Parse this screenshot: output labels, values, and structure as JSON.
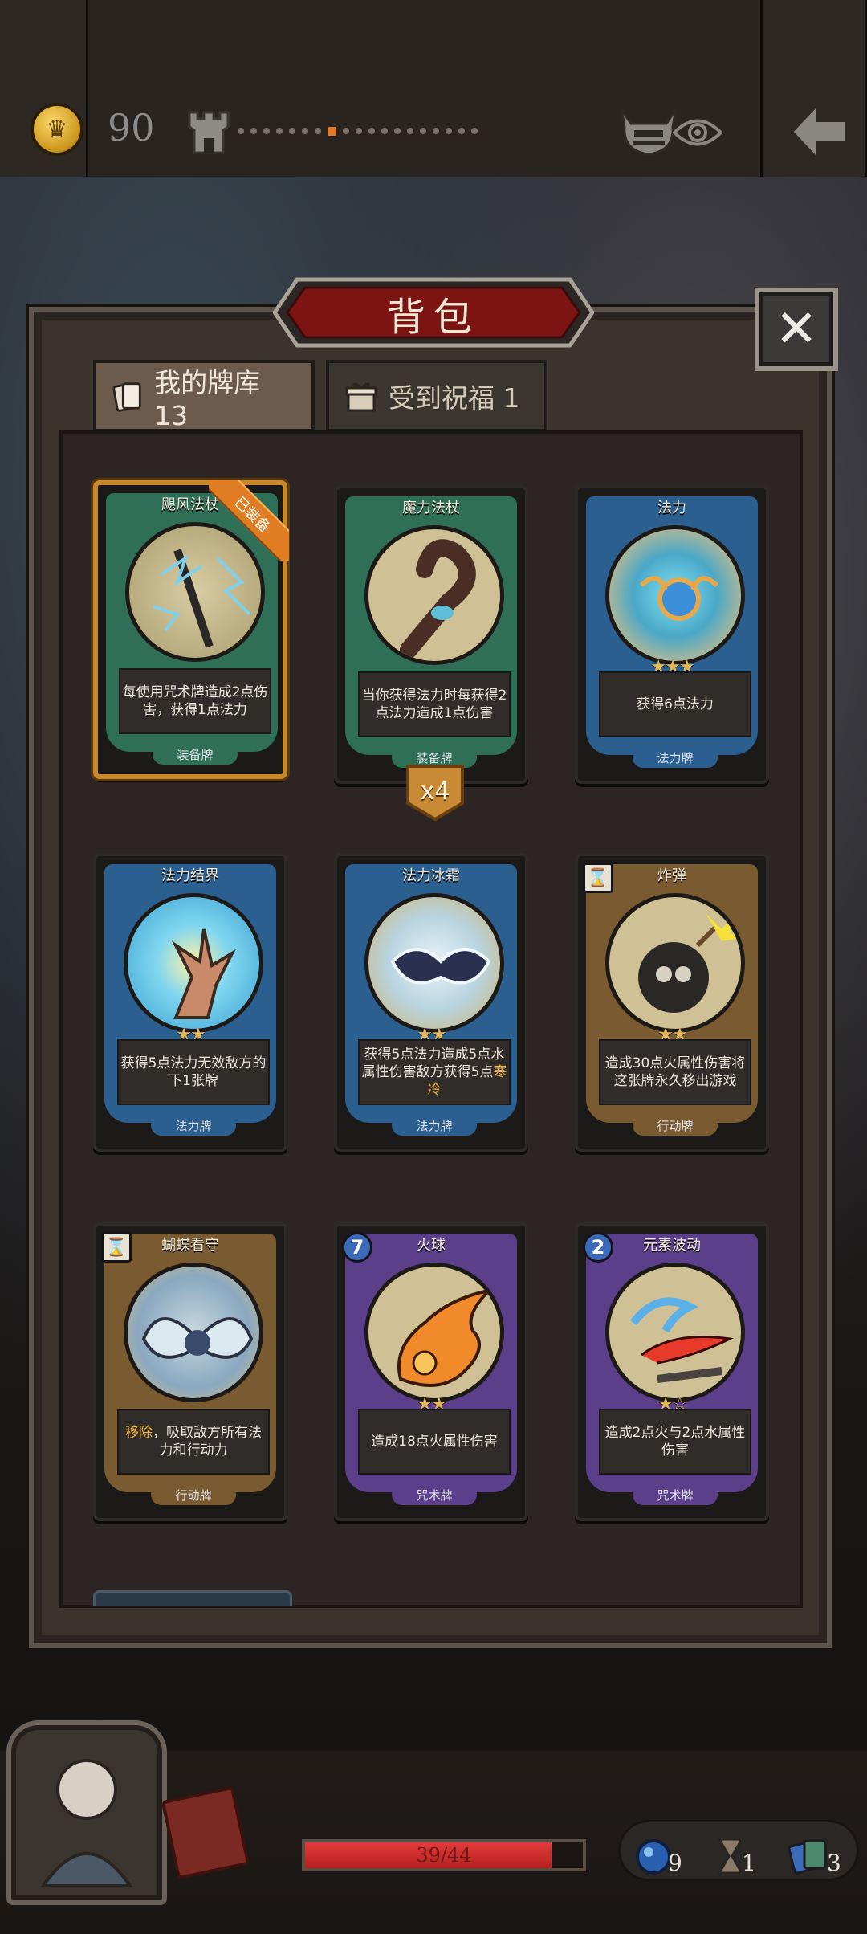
{
  "hud": {
    "gold": "90",
    "icons": [
      "coin-icon",
      "tower-icon",
      "boss-icon",
      "eye-icon",
      "back-arrow-icon"
    ],
    "path_nodes": 19,
    "path_current": 7
  },
  "panel": {
    "title": "背包",
    "close_symbol": "✕",
    "tabs": [
      {
        "label": "我的牌库 13",
        "active": true
      },
      {
        "label": "受到祝福 1",
        "active": false
      }
    ]
  },
  "cards": [
    {
      "name": "飓风法杖",
      "desc": "每使用咒术牌造成2点伤害，获得1点法力",
      "type": "装备牌",
      "badge": "已装备",
      "color": "#2f6f58",
      "stars": ""
    },
    {
      "name": "魔力法杖",
      "desc": "当你获得法力时每获得2点法力造成1点伤害",
      "type": "装备牌",
      "qty": "x4",
      "color": "#2f6f58",
      "stars": ""
    },
    {
      "name": "法力",
      "desc": "获得6点法力",
      "type": "法力牌",
      "color": "#2b5f8f",
      "stars": "★★★"
    },
    {
      "name": "法力结界",
      "desc": "获得5点法力无效敌方的下1张牌",
      "type": "法力牌",
      "color": "#2b5f8f",
      "stars": "★★"
    },
    {
      "name": "法力冰霜",
      "desc_pre": "获得5点法力造成5点水属性伤害敌方获得5点",
      "desc_hl": "寒冷",
      "type": "法力牌",
      "color": "#2b5f8f",
      "stars": "★★"
    },
    {
      "name": "炸弹",
      "cost": "⌛",
      "desc": "造成30点火属性伤害将这张牌永久移出游戏",
      "type": "行动牌",
      "color": "#7a5a30",
      "stars": "★★"
    },
    {
      "name": "蝴蝶看守",
      "cost": "⌛",
      "desc_hl": "移除",
      "desc_post": "，吸取敌方所有法力和行动力",
      "type": "行动牌",
      "color": "#7a5a30",
      "stars": ""
    },
    {
      "name": "火球",
      "cost": "7",
      "desc": "造成18点火属性伤害",
      "type": "咒术牌",
      "color": "#5c3f8a",
      "stars": "★★"
    },
    {
      "name": "元素波动",
      "cost": "2",
      "desc": "造成2点火与2点水属性伤害",
      "type": "咒术牌",
      "color": "#5c3f8a",
      "stars": "★☆"
    }
  ],
  "player": {
    "hp": "39/44",
    "hp_fraction": 0.886,
    "mana": "9",
    "time": "1",
    "cards": "3"
  },
  "colors": {
    "equipped_border": "#c9892a",
    "hp_red": "#d22c2c",
    "path_current": "#e07a2a"
  }
}
